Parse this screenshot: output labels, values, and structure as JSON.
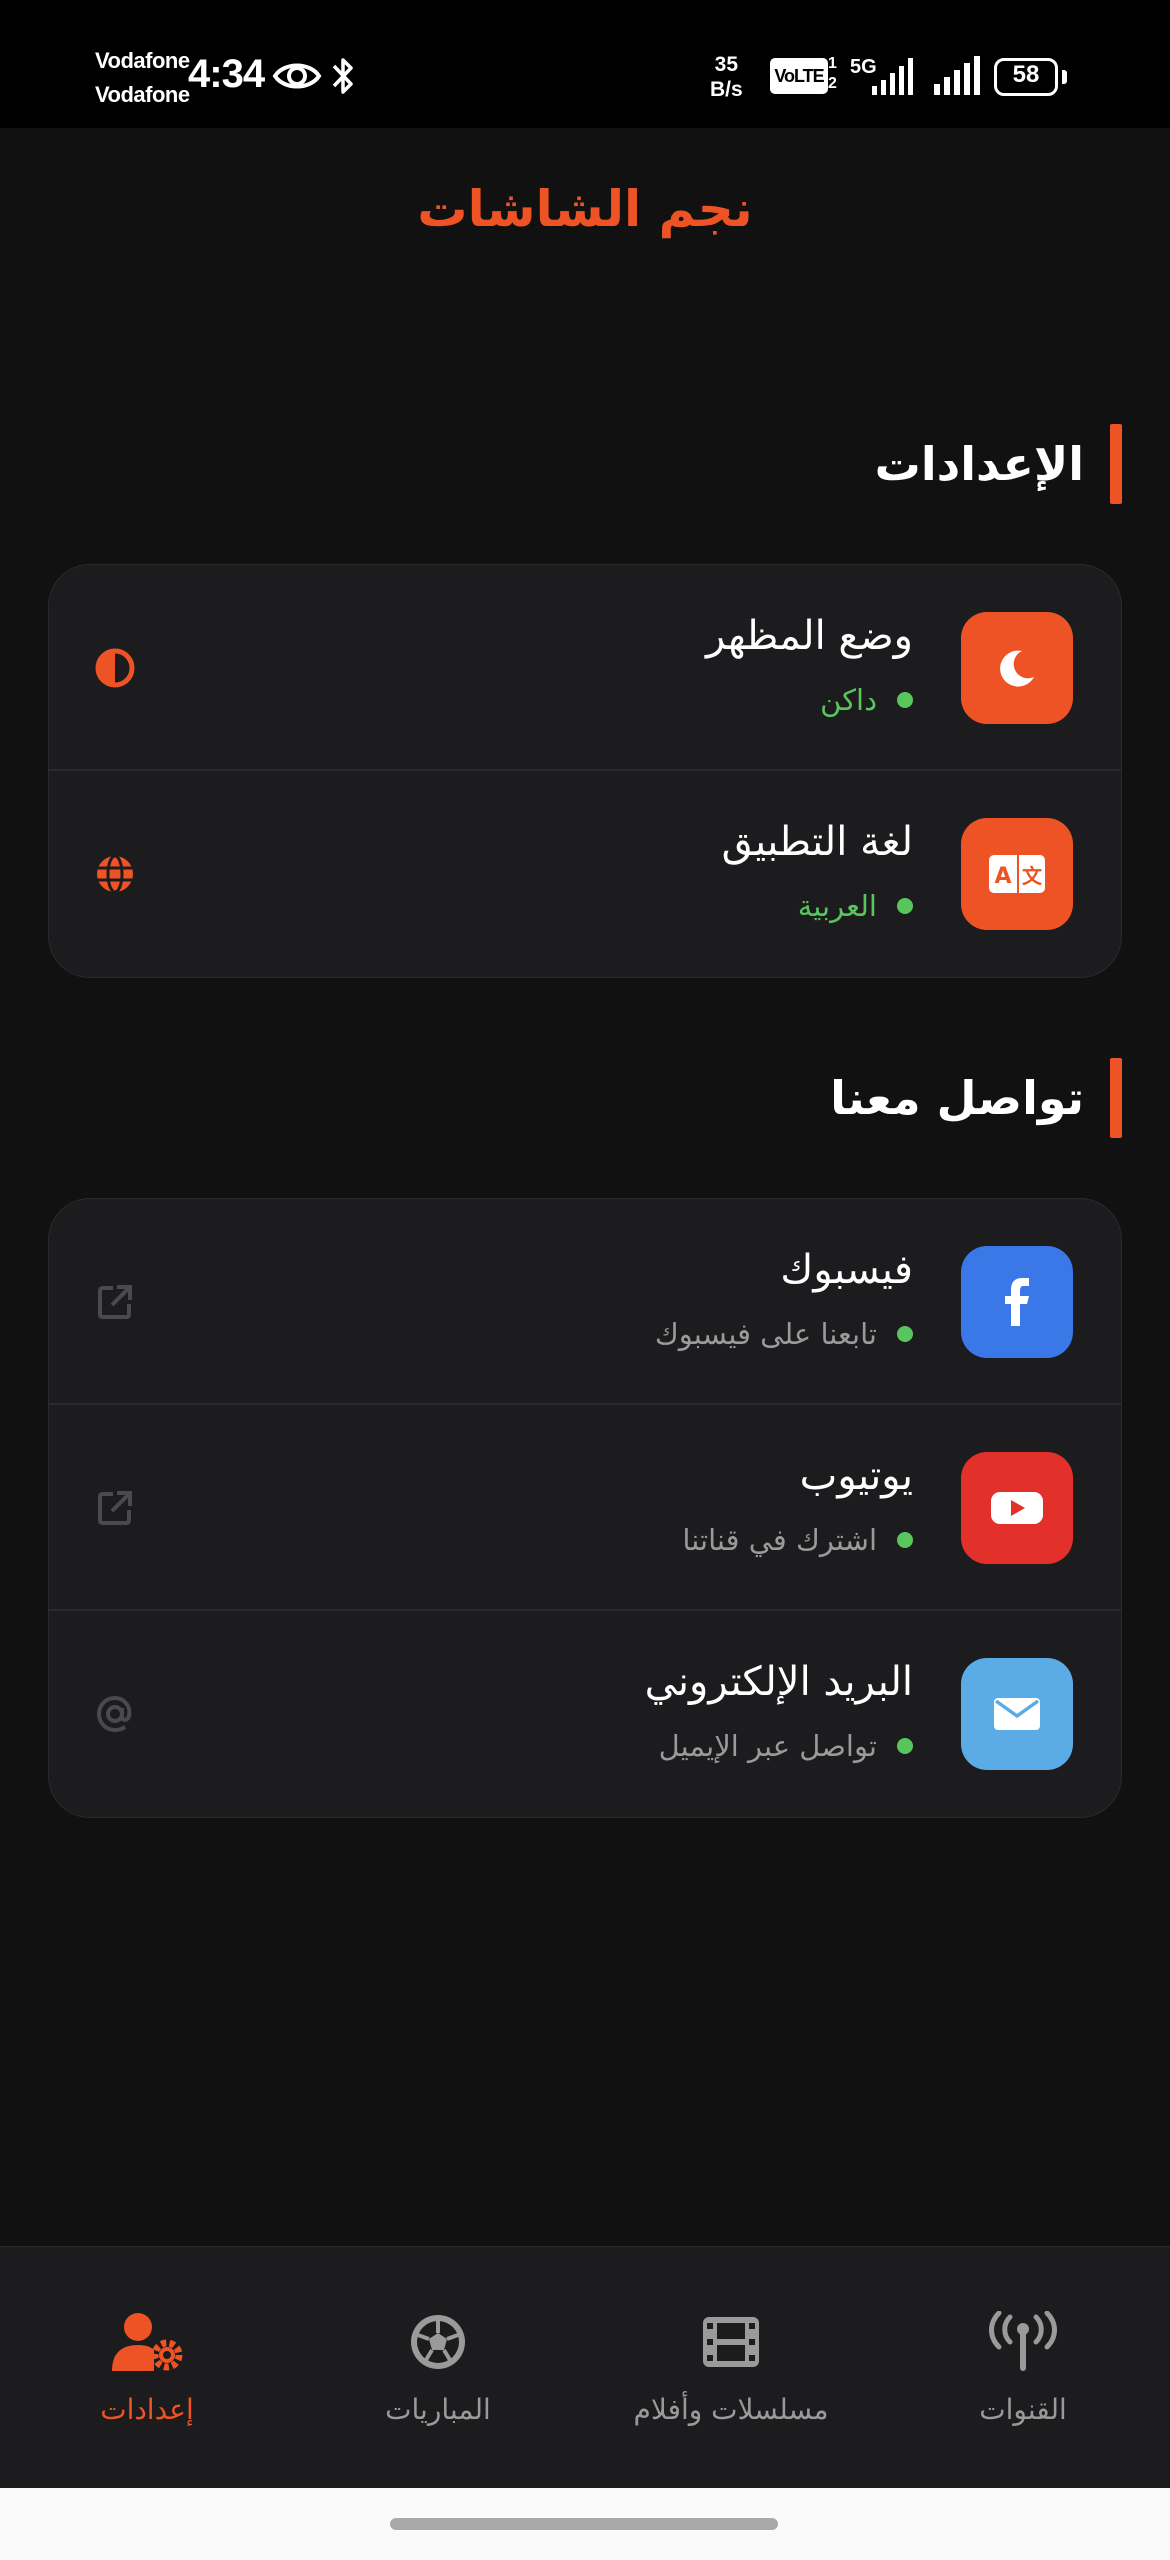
{
  "status_bar": {
    "carrier_1": "Vodafone",
    "carrier_2": "Vodafone",
    "time": "4:34",
    "net_speed_value": "35",
    "net_speed_unit": "B/s",
    "volte": "VoLTE",
    "sim_1": "1",
    "sim_2": "2",
    "network_type": "5G",
    "battery": "58",
    "icons": [
      "eye-icon",
      "bluetooth-icon",
      "signal-icon",
      "battery-icon"
    ]
  },
  "header": {
    "title": "نجم الشاشات"
  },
  "settings_section": {
    "title": "الإعدادات",
    "items": [
      {
        "title": "وضع المظهر",
        "subtitle": "داكن",
        "icon": "moon-icon",
        "action_icon": "contrast-icon"
      },
      {
        "title": "لغة التطبيق",
        "subtitle": "العربية",
        "icon": "translate-icon",
        "action_icon": "globe-icon"
      }
    ]
  },
  "contact_section": {
    "title": "تواصل معنا",
    "items": [
      {
        "title": "فيسبوك",
        "subtitle": "تابعنا على فيسبوك",
        "icon": "facebook-icon",
        "action_icon": "external-link-icon"
      },
      {
        "title": "يوتيوب",
        "subtitle": "اشترك في قناتنا",
        "icon": "youtube-icon",
        "action_icon": "external-link-icon"
      },
      {
        "title": "البريد الإلكتروني",
        "subtitle": "تواصل عبر الإيميل",
        "icon": "envelope-icon",
        "action_icon": "at-icon"
      }
    ]
  },
  "bottom_nav": {
    "items": [
      {
        "label": "إعدادات",
        "icon": "user-gear-icon",
        "active": true
      },
      {
        "label": "المباريات",
        "icon": "soccer-ball-icon",
        "active": false
      },
      {
        "label": "مسلسلات وأفلام",
        "icon": "film-icon",
        "active": false
      },
      {
        "label": "القنوات",
        "icon": "antenna-icon",
        "active": false
      }
    ]
  },
  "colors": {
    "accent": "#ee5325",
    "background": "#111111",
    "card": "#1c1c1e",
    "status_green": "#58c55d",
    "muted_text": "#9a9a9a",
    "facebook": "#3b78e7",
    "youtube": "#e3302a",
    "email": "#5aabe6"
  }
}
